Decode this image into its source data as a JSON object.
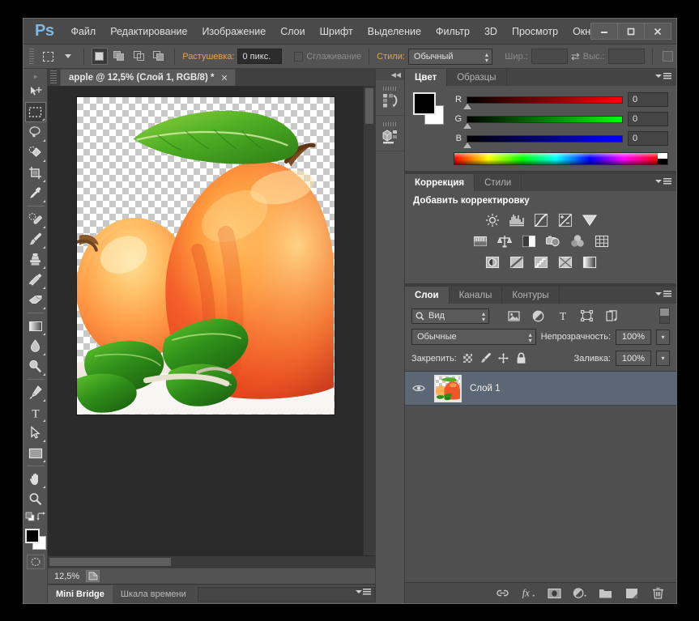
{
  "app": {
    "logo": "Ps",
    "menus": [
      "Файл",
      "Редактирование",
      "Изображение",
      "Слои",
      "Шрифт",
      "Выделение",
      "Фильтр",
      "3D",
      "Просмотр",
      "Окно"
    ],
    "window_controls": {
      "minimize": "—",
      "maximize": "❐",
      "close": "✕"
    }
  },
  "options_bar": {
    "tool_preset_icon": "rectangular-marquee-icon",
    "selection_modes": [
      "new-selection",
      "add-to-selection",
      "subtract-from-selection",
      "intersect-selection"
    ],
    "feather_label": "Растушевка:",
    "feather_value": "0 пикс.",
    "antialias_label": "Сглаживание",
    "style_label": "Стили:",
    "style_value": "Обычный",
    "width_label": "Шир.:",
    "width_value": "",
    "height_label": "Выс.:",
    "height_value": ""
  },
  "toolbox": {
    "tools": [
      {
        "name": "move-tool",
        "has_flyout": false,
        "selected": false
      },
      {
        "name": "rectangular-marquee-tool",
        "has_flyout": true,
        "selected": true
      },
      {
        "name": "lasso-tool",
        "has_flyout": true,
        "selected": false
      },
      {
        "name": "quick-selection-tool",
        "has_flyout": true,
        "selected": false
      },
      {
        "name": "crop-tool",
        "has_flyout": true,
        "selected": false
      },
      {
        "name": "eyedropper-tool",
        "has_flyout": true,
        "selected": false
      },
      {
        "name": "spot-healing-brush-tool",
        "has_flyout": true,
        "selected": false
      },
      {
        "name": "brush-tool",
        "has_flyout": true,
        "selected": false
      },
      {
        "name": "clone-stamp-tool",
        "has_flyout": true,
        "selected": false
      },
      {
        "name": "history-brush-tool",
        "has_flyout": true,
        "selected": false
      },
      {
        "name": "eraser-tool",
        "has_flyout": true,
        "selected": false
      },
      {
        "name": "gradient-tool",
        "has_flyout": true,
        "selected": false
      },
      {
        "name": "blur-tool",
        "has_flyout": true,
        "selected": false
      },
      {
        "name": "dodge-tool",
        "has_flyout": true,
        "selected": false
      },
      {
        "name": "pen-tool",
        "has_flyout": true,
        "selected": false
      },
      {
        "name": "horizontal-type-tool",
        "has_flyout": true,
        "selected": false
      },
      {
        "name": "path-selection-tool",
        "has_flyout": true,
        "selected": false
      },
      {
        "name": "rectangle-tool",
        "has_flyout": true,
        "selected": false
      },
      {
        "name": "hand-tool",
        "has_flyout": true,
        "selected": false
      },
      {
        "name": "zoom-tool",
        "has_flyout": false,
        "selected": false
      }
    ],
    "foreground_color": "#000000",
    "background_color": "#ffffff"
  },
  "document": {
    "tab_title": "apple @ 12,5% (Слой 1, RGB/8) *",
    "tab_close": "✕",
    "zoom_level": "12,5%"
  },
  "bottom_dock": {
    "tabs": [
      {
        "label": "Mini Bridge",
        "active": true
      },
      {
        "label": "Шкала времени",
        "active": false
      }
    ]
  },
  "color_panel": {
    "tabs": [
      {
        "label": "Цвет",
        "active": true
      },
      {
        "label": "Образцы",
        "active": false
      }
    ],
    "channels": [
      {
        "label": "R",
        "value": "0"
      },
      {
        "label": "G",
        "value": "0"
      },
      {
        "label": "B",
        "value": "0"
      }
    ],
    "foreground": "#000000",
    "background": "#ffffff"
  },
  "adjustments_panel": {
    "tabs": [
      {
        "label": "Коррекция",
        "active": true
      },
      {
        "label": "Стили",
        "active": false
      }
    ],
    "title": "Добавить корректировку",
    "row1": [
      "brightness-contrast-icon",
      "levels-icon",
      "curves-icon",
      "exposure-icon",
      "vibrance-icon"
    ],
    "row2": [
      "hue-saturation-icon",
      "color-balance-icon",
      "black-white-icon",
      "photo-filter-icon",
      "channel-mixer-icon",
      "color-lookup-icon"
    ],
    "row3": [
      "invert-icon",
      "posterize-icon",
      "threshold-icon",
      "selective-color-icon",
      "gradient-map-icon"
    ]
  },
  "layers_panel": {
    "tabs": [
      {
        "label": "Слои",
        "active": true
      },
      {
        "label": "Каналы",
        "active": false
      },
      {
        "label": "Контуры",
        "active": false
      }
    ],
    "filter_value": "Вид",
    "filter_icons": [
      "pixel-layer-filter-icon",
      "adjustment-layer-filter-icon",
      "type-layer-filter-icon",
      "shape-layer-filter-icon",
      "smart-object-filter-icon"
    ],
    "blend_mode": "Обычные",
    "opacity_label": "Непрозрачность:",
    "opacity_value": "100%",
    "lock_label": "Закрепить:",
    "lock_icons": [
      "lock-transparent-pixels-icon",
      "lock-image-pixels-icon",
      "lock-position-icon",
      "lock-all-icon"
    ],
    "fill_label": "Заливка:",
    "fill_value": "100%",
    "layers": [
      {
        "name": "Слой 1",
        "visible": true,
        "selected": true
      }
    ],
    "footer_icons": [
      "link-layers-icon",
      "layer-style-fx-icon",
      "add-layer-mask-icon",
      "new-adjustment-layer-icon",
      "new-group-icon",
      "new-layer-icon",
      "delete-layer-icon"
    ]
  },
  "icon_rail": {
    "buttons": [
      "history-panel-icon",
      "3d-panel-icon"
    ]
  }
}
